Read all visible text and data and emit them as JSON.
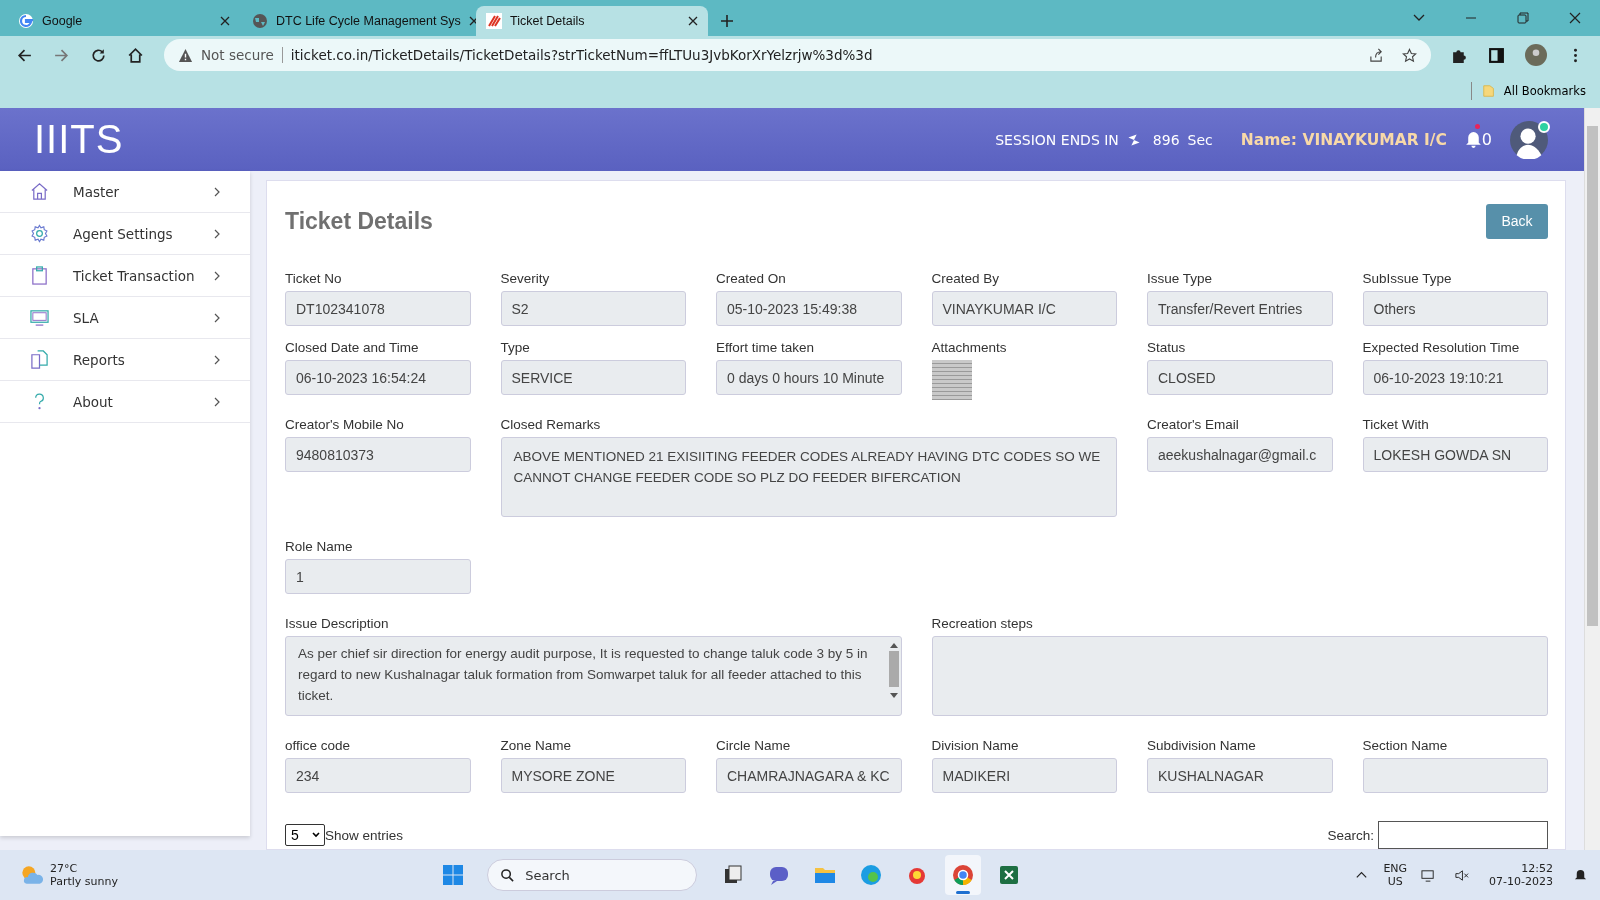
{
  "browser": {
    "tabs": [
      {
        "title": "Google",
        "kind": "google",
        "selected": false
      },
      {
        "title": "DTC Life Cycle Management Sys",
        "kind": "globe",
        "selected": false
      },
      {
        "title": "Ticket Details",
        "kind": "site",
        "selected": true
      }
    ],
    "security": "Not secure",
    "url": "iticket.co.in/TicketDetails/TicketDetails?strTicketNum=ffLTUu3JvbKorXrYelzrjw%3d%3d",
    "bookmarks": "All Bookmarks"
  },
  "header": {
    "logo": "IIITS",
    "session_label": "SESSION ENDS IN",
    "session_count": "896",
    "session_unit": "Sec",
    "user_name": "Name: VINAYKUMAR I/C",
    "notification_count": "0"
  },
  "sidebar": {
    "items": [
      {
        "label": "Master",
        "kind": "home"
      },
      {
        "label": "Agent Settings",
        "kind": "gear"
      },
      {
        "label": "Ticket Transaction",
        "kind": "clipboard"
      },
      {
        "label": "SLA",
        "kind": "monitor"
      },
      {
        "label": "Reports",
        "kind": "documents"
      },
      {
        "label": "About",
        "kind": "question"
      }
    ]
  },
  "page": {
    "title": "Ticket Details",
    "back_button": "Back",
    "field_groups": [
      {
        "fields": [
          {
            "label": "Ticket No",
            "value": "DT102341078",
            "kind": "text"
          },
          {
            "label": "Severity",
            "value": "S2",
            "kind": "text"
          },
          {
            "label": "Created On",
            "value": "05-10-2023 15:49:38",
            "kind": "text"
          },
          {
            "label": "Created By",
            "value": "VINAYKUMAR I/C",
            "kind": "text"
          },
          {
            "label": "Issue Type",
            "value": "Transfer/Revert Entries",
            "kind": "text"
          },
          {
            "label": "SubIssue Type",
            "value": "Others",
            "kind": "text"
          }
        ]
      },
      {
        "fields": [
          {
            "label": "Closed Date and Time",
            "value": "06-10-2023 16:54:24",
            "kind": "text"
          },
          {
            "label": "Type",
            "value": "SERVICE",
            "kind": "text"
          },
          {
            "label": "Effort time taken",
            "value": "0 days 0 hours 10 Minute",
            "kind": "text"
          },
          {
            "label": "Attachments",
            "kind": "attachment"
          },
          {
            "label": "Status",
            "value": "CLOSED",
            "kind": "text"
          },
          {
            "label": "Expected Resolution Time",
            "value": "06-10-2023 19:10:21",
            "kind": "text"
          }
        ]
      },
      {
        "fields": [
          {
            "label": "Creator's Mobile No",
            "value": "9480810373",
            "kind": "text"
          },
          {
            "label": "Closed Remarks",
            "value": "ABOVE MENTIONED 21 EXISIITING FEEDER CODES ALREADY HAVING DTC CODES SO WE CANNOT CHANGE FEEDER CODE SO PLZ DO FEEDER BIFERCATION",
            "kind": "textarea"
          },
          {
            "label": "Creator's Email",
            "value": "aeekushalnagar@gmail.c",
            "kind": "text"
          },
          {
            "label": "Ticket With",
            "value": "LOKESH GOWDA SN",
            "kind": "text"
          }
        ]
      },
      {
        "fields": [
          {
            "label": "Role Name",
            "value": "1",
            "kind": "text"
          }
        ]
      },
      {
        "fields": [
          {
            "label": "Issue Description",
            "value": "As per chief sir direction  for energy audit purpose,  It is requested to change taluk code 3 by 5 in regard to new Kushalnagar taluk  formation from Somwarpet taluk for all feeder attached to this ticket.",
            "kind": "scrolltext"
          },
          {
            "label": "Recreation steps",
            "kind": "textarea"
          }
        ]
      },
      {
        "fields": [
          {
            "label": "office code",
            "value": "234",
            "kind": "text"
          },
          {
            "label": "Zone Name",
            "value": "MYSORE ZONE",
            "kind": "text"
          },
          {
            "label": "Circle Name",
            "value": "CHAMRAJNAGARA & KC",
            "kind": "text"
          },
          {
            "label": "Division Name",
            "value": "MADIKERI",
            "kind": "text"
          },
          {
            "label": "Subdivision Name",
            "value": "KUSHALNAGAR",
            "kind": "text"
          },
          {
            "label": "Section Name",
            "kind": "text"
          }
        ]
      }
    ],
    "entries_value": "5",
    "entries_label": "Show entries",
    "search_label": "Search:"
  },
  "taskbar": {
    "temperature": "27°C",
    "weather": "Partly sunny",
    "search_placeholder": "Search",
    "apps": [
      {
        "kind": "files",
        "selected": false
      },
      {
        "kind": "chat",
        "selected": false
      },
      {
        "kind": "folder",
        "selected": false
      },
      {
        "kind": "edge",
        "selected": false
      },
      {
        "kind": "app",
        "selected": false
      },
      {
        "kind": "chrome",
        "selected": true
      },
      {
        "kind": "excel",
        "selected": false
      }
    ],
    "language": "ENG",
    "region": "US",
    "time": "12:52",
    "date": "07-10-2023"
  }
}
